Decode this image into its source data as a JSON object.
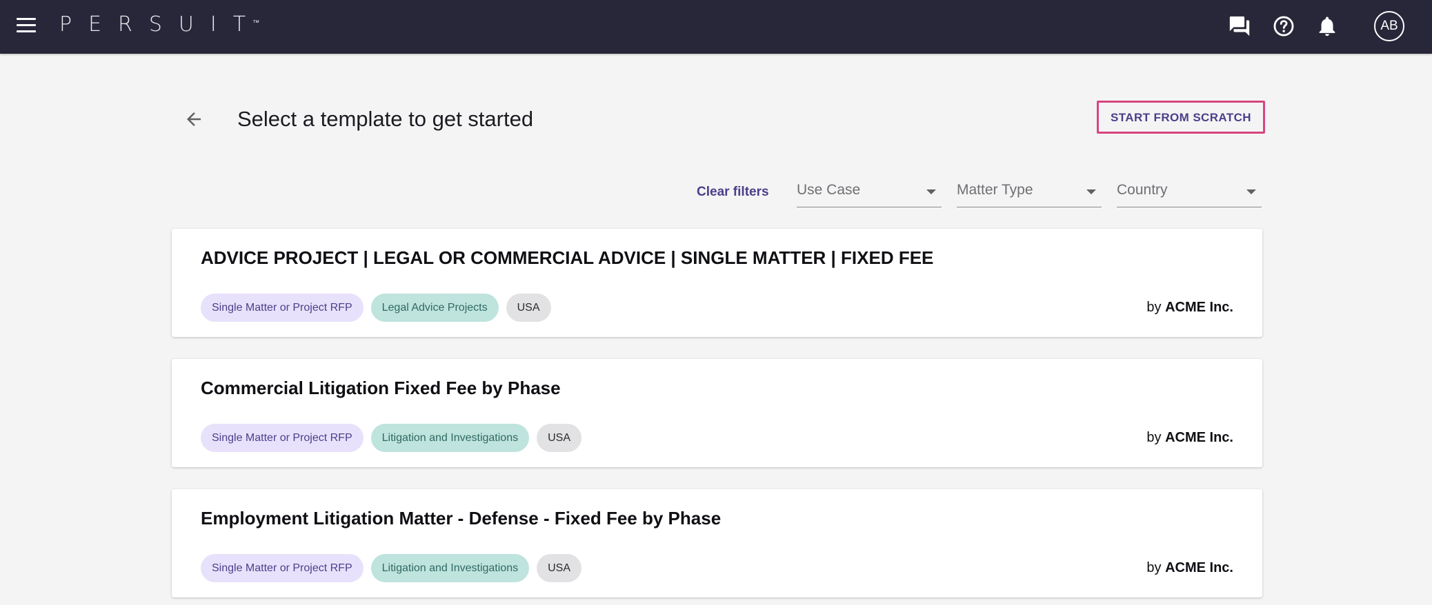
{
  "app": {
    "logo_text": "PERSUIT",
    "logo_mark": "™",
    "user_initials": "AB"
  },
  "icons": {
    "menu": "menu-icon",
    "chat": "chat-icon",
    "help": "help-icon",
    "notifications": "bell-icon",
    "back": "arrow-left-icon",
    "dropdown": "chevron-down-icon"
  },
  "colors": {
    "topbar": "#28273a",
    "accent": "#4a3f8a",
    "highlight_border": "#d6457f",
    "chip_purple": "#e8e1fb",
    "chip_teal": "#bfe3dd",
    "chip_grey": "#e2e2e4"
  },
  "header": {
    "title": "Select a template to get started",
    "start_button": "START FROM SCRATCH"
  },
  "filters": {
    "clear_label": "Clear filters",
    "use_case": "Use Case",
    "matter_type": "Matter Type",
    "country": "Country"
  },
  "templates": [
    {
      "title": "ADVICE PROJECT | LEGAL OR COMMERCIAL ADVICE | SINGLE MATTER | FIXED FEE",
      "tags": [
        "Single Matter or Project RFP",
        "Legal Advice Projects",
        "USA"
      ],
      "by_prefix": "by",
      "author": "ACME Inc."
    },
    {
      "title": "Commercial Litigation Fixed Fee by Phase",
      "tags": [
        "Single Matter or Project RFP",
        "Litigation and Investigations",
        "USA"
      ],
      "by_prefix": "by",
      "author": "ACME Inc."
    },
    {
      "title": "Employment Litigation Matter - Defense - Fixed Fee by Phase",
      "tags": [
        "Single Matter or Project RFP",
        "Litigation and Investigations",
        "USA"
      ],
      "by_prefix": "by",
      "author": "ACME Inc."
    }
  ]
}
